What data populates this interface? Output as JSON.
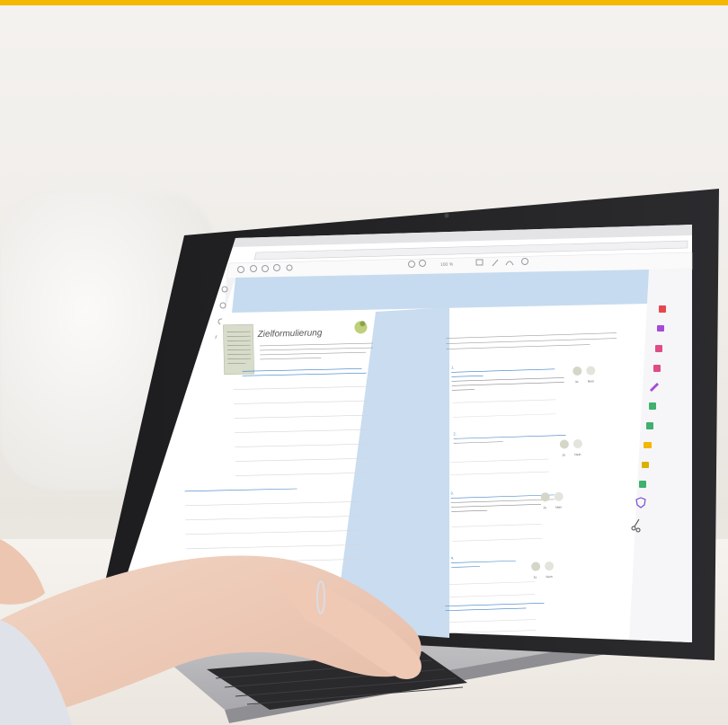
{
  "header": {
    "accent_color": "#f5b800"
  },
  "screen": {
    "toolbar": {
      "zoom_label": "100 %"
    },
    "left_page": {
      "section_title": "Zielformulierung"
    },
    "right_page": {
      "questions": [
        {
          "number": "1.",
          "yes_label": "Ja",
          "no_label": "Nein"
        },
        {
          "number": "2.",
          "yes_label": "Ja",
          "no_label": "Nein"
        },
        {
          "number": "3.",
          "yes_label": "Ja",
          "no_label": "Nein"
        },
        {
          "number": "4.",
          "yes_label": "Ja",
          "no_label": "Nein"
        }
      ]
    },
    "right_tool_icons": [
      "pdf-icon",
      "comment-icon",
      "edit-icon",
      "export-icon",
      "sign-icon",
      "organize-icon",
      "folder-icon",
      "stamp-icon",
      "print-icon",
      "protect-icon",
      "scissors-icon"
    ]
  }
}
